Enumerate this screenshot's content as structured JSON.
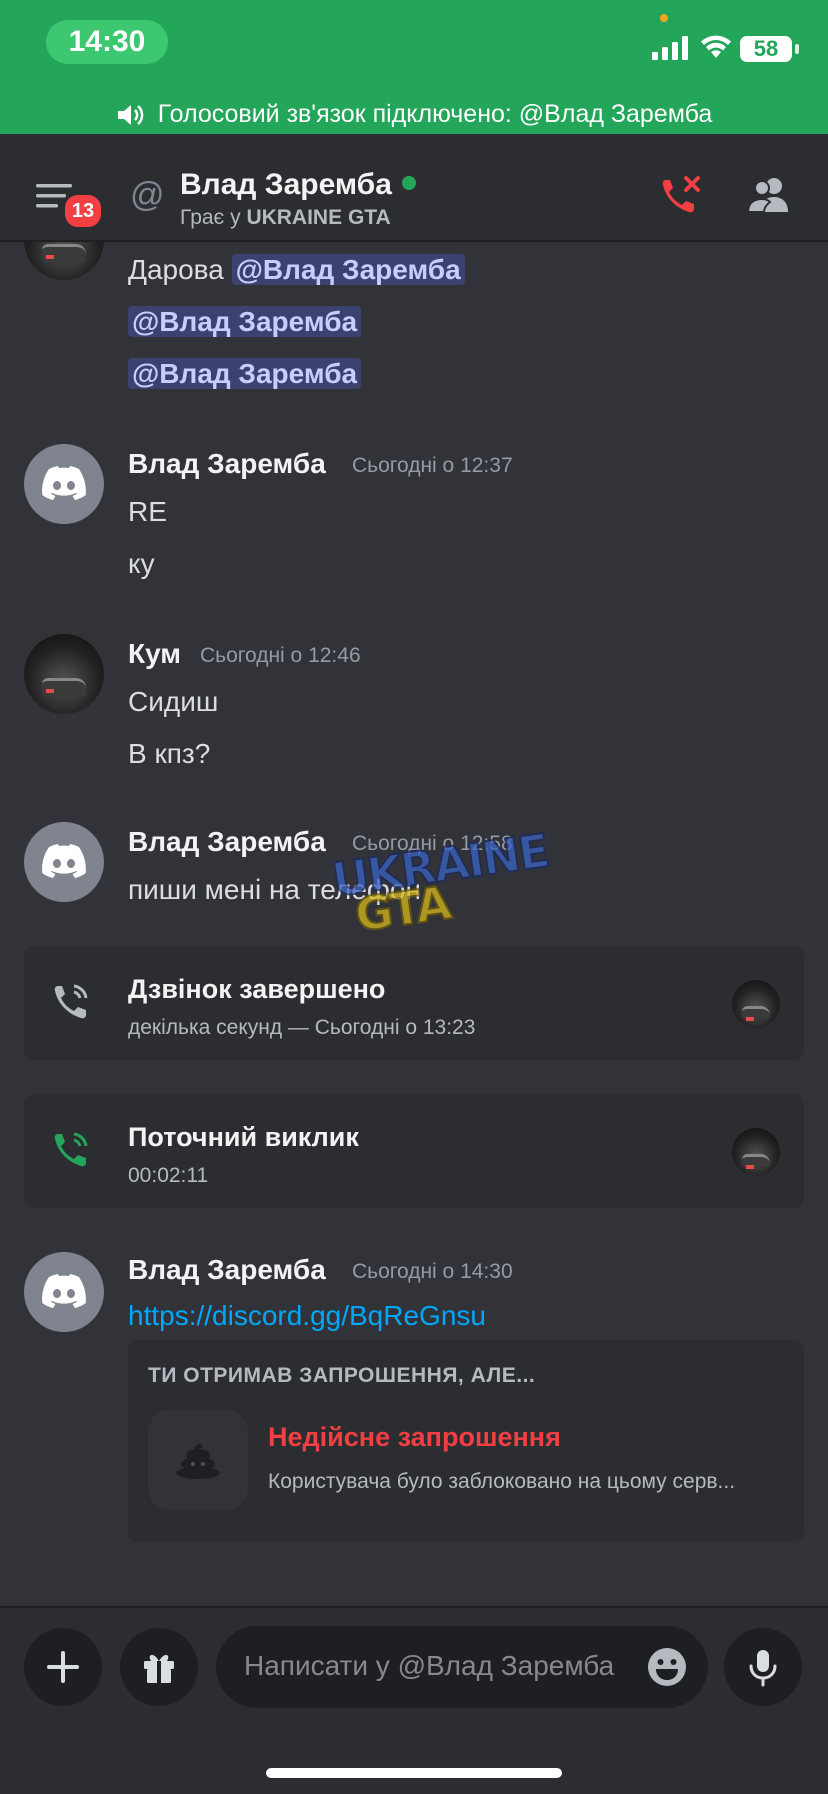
{
  "status_bar": {
    "time": "14:30",
    "battery": "58"
  },
  "voice_banner": {
    "text": "Голосовий зв'язок підключено: @Влад Заремба"
  },
  "header": {
    "badge_count": "13",
    "title": "Влад Заремба",
    "status_prefix": "Грає у ",
    "status_game": "UKRAINE GTA"
  },
  "messages": {
    "top": {
      "line1_text": "Дарова ",
      "line1_mention": "@Влад Заремба",
      "line2_mention": "@Влад Заремба",
      "line3_mention": "@Влад Заремба"
    },
    "m1": {
      "author": "Влад Заремба",
      "time": "Сьогодні о 12:37",
      "lines": [
        "RE",
        "ку"
      ]
    },
    "m2": {
      "author": "Кум",
      "time": "Сьогодні о 12:46",
      "lines": [
        "Сидиш",
        "В кпз?"
      ]
    },
    "m3": {
      "author": "Влад Заремба",
      "time": "Сьогодні о 12:58",
      "lines": [
        "пиши мені на телефон"
      ]
    },
    "call_ended": {
      "title": "Дзвінок завершено",
      "subtitle": "декілька секунд — Сьогодні о 13:23"
    },
    "call_current": {
      "title": "Поточний виклик",
      "subtitle": "00:02:11"
    },
    "m4": {
      "author": "Влад Заремба",
      "time": "Сьогодні о 14:30",
      "link": "https://discord.gg/BqReGnsu"
    },
    "invite": {
      "header": "ТИ ОТРИМАВ ЗАПРОШЕННЯ, АЛЕ...",
      "title": "Недійсне запрошення",
      "description": "Користувача було заблоковано на цьому серв..."
    }
  },
  "watermark": {
    "line1": "UKRAINE",
    "line2": "GTA"
  },
  "composer": {
    "placeholder": "Написати у @Влад Заремба"
  },
  "colors": {
    "status_bar_green": "#23a55a",
    "background": "#313338",
    "link": "#00a8fc",
    "danger": "#f23f43",
    "mention_bg": "#3c4270"
  },
  "icons": [
    "speaker-icon",
    "hamburger-icon",
    "at-icon",
    "hangup-icon",
    "members-icon",
    "call-ended-icon",
    "call-active-icon",
    "plus-icon",
    "gift-icon",
    "emoji-icon",
    "microphone-icon",
    "discord-logo-icon",
    "poop-icon"
  ]
}
